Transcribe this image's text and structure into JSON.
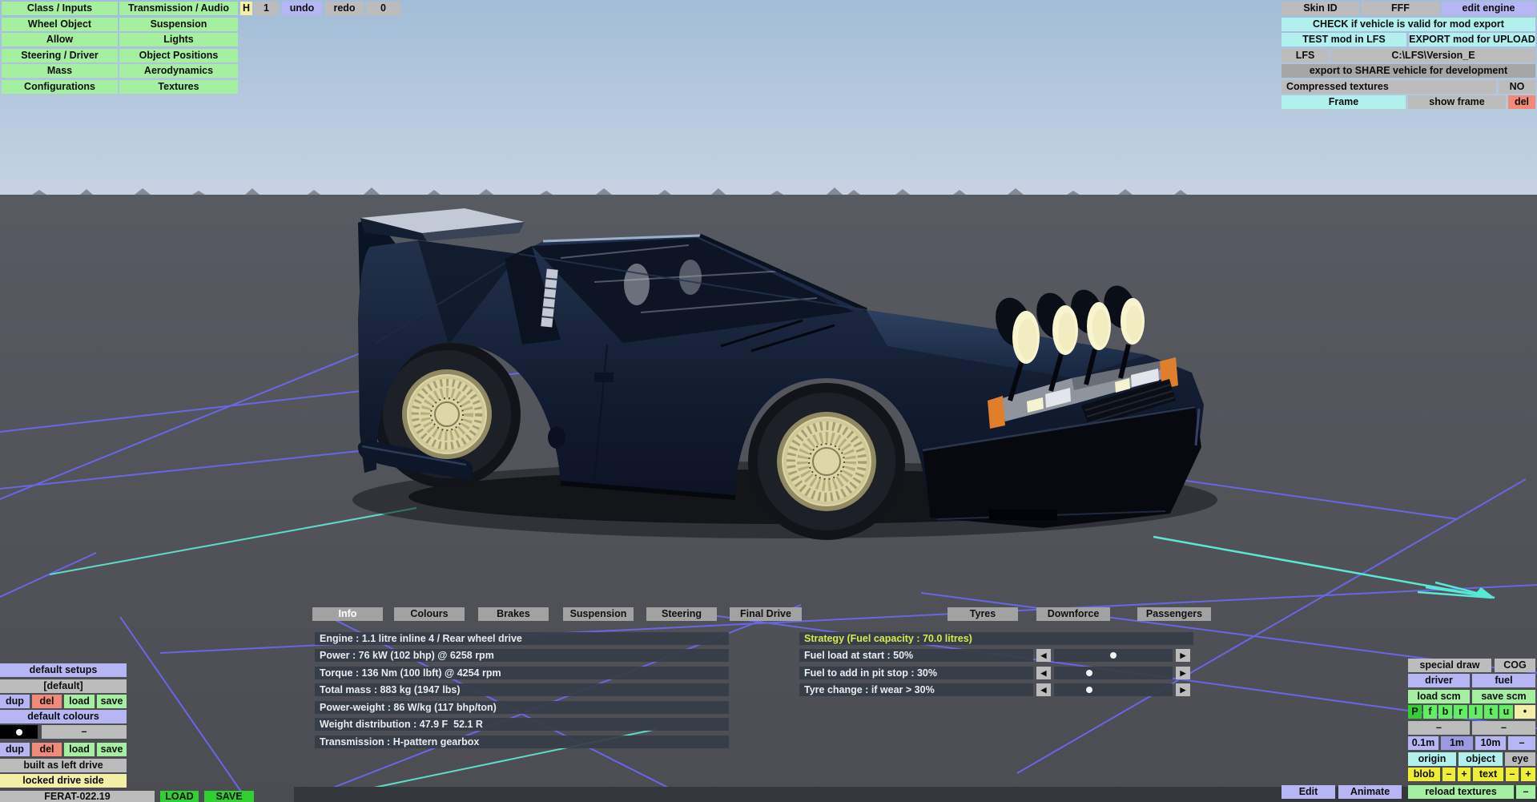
{
  "left_menu": {
    "col1": [
      "Class / Inputs",
      "Wheel Object",
      "Allow",
      "Steering / Driver",
      "Mass",
      "Configurations"
    ],
    "col2": [
      "Transmission / Audio",
      "Suspension",
      "Lights",
      "Object Positions",
      "Aerodynamics",
      "Textures"
    ]
  },
  "history_bar": {
    "handle": "H",
    "count": "1",
    "undo": "undo",
    "redo": "redo",
    "zero": "0"
  },
  "export_panel": {
    "skin_id": "Skin ID",
    "skin_value": "FFF",
    "edit_engine": "edit engine",
    "check": "CHECK if vehicle is valid for mod export",
    "test": "TEST mod in LFS",
    "export_upload": "EXPORT mod for UPLOAD",
    "lfs": "LFS",
    "lfs_path": "C:\\LFS\\Version_E",
    "share": "export to SHARE vehicle for development",
    "compressed_label": "Compressed textures",
    "compressed_value": "NO",
    "frame": "Frame",
    "show_frame": "show frame",
    "del": "del"
  },
  "tabs": [
    {
      "label": "Info",
      "selected": true
    },
    {
      "label": "Colours",
      "selected": false
    },
    {
      "label": "Brakes",
      "selected": false
    },
    {
      "label": "Suspension",
      "selected": false
    },
    {
      "label": "Steering",
      "selected": false
    },
    {
      "label": "Final Drive",
      "selected": false
    },
    {
      "label": "Tyres",
      "selected": false
    },
    {
      "label": "Downforce",
      "selected": false
    },
    {
      "label": "Passengers",
      "selected": false
    }
  ],
  "info_panel": {
    "rows": [
      "Engine : 1.1 litre inline 4 / Rear wheel drive",
      "Power : 76 kW (102 bhp) @ 6258 rpm",
      "Torque : 136 Nm (100 lbft) @ 4254 rpm",
      "Total mass : 883 kg (1947 lbs)",
      "Power-weight : 86 W/kg (117 bhp/ton)",
      "Weight distribution : 47.9 F  52.1 R",
      "Transmission : H-pattern gearbox"
    ]
  },
  "strategy_panel": {
    "header": "Strategy (Fuel capacity : 70.0 litres)",
    "rows": [
      {
        "label": "Fuel load at start : 50%",
        "value": 50
      },
      {
        "label": "Fuel to add in pit stop : 30%",
        "value": 30
      },
      {
        "label": "Tyre change : if wear > 30%",
        "value": 30
      }
    ]
  },
  "setups_panel": {
    "default_setups": "default setups",
    "current_setup": "[default]",
    "dup": "dup",
    "del": "del",
    "load": "load",
    "save": "save",
    "default_colours": "default colours",
    "colour_none": "–",
    "built_as": "built as left drive",
    "locked_side": "locked drive side"
  },
  "file_bar": {
    "vehicle_file": "FERAT-022.19",
    "load": "LOAD",
    "save": "SAVE"
  },
  "view_panel": {
    "special_draw": "special draw",
    "cog": "COG",
    "driver": "driver",
    "fuel": "fuel",
    "load_scm": "load scm",
    "save_scm": "save scm",
    "wheel_keys": [
      "P",
      "f",
      "b",
      "r",
      "l",
      "t",
      "u"
    ],
    "dot": "•",
    "dash_a": "–",
    "dash_b": "–",
    "scale_01": "0.1m",
    "scale_1": "1m",
    "scale_10": "10m",
    "scale_dash": "–",
    "origin": "origin",
    "object": "object",
    "eye": "eye",
    "blob": "blob",
    "blob_minus": "–",
    "blob_plus": "+",
    "text": "text",
    "text_minus": "–",
    "text_plus": "+",
    "edit": "Edit",
    "animate": "Animate",
    "reload_textures": "reload textures",
    "reload_dash": "–"
  },
  "colors": {
    "button_green": "#a4f0a0",
    "button_cyan": "#b2f0ee",
    "button_lavender": "#b6b6f4",
    "button_yellow": "#f2f0a6",
    "button_salmon": "#f28a7a",
    "bright_green": "#30d030",
    "bright_yellow": "#f0ee32",
    "grid_purple": "#6b68ee",
    "grid_teal": "#5ce5cf",
    "strategy_header_text": "#d8ea4c"
  }
}
